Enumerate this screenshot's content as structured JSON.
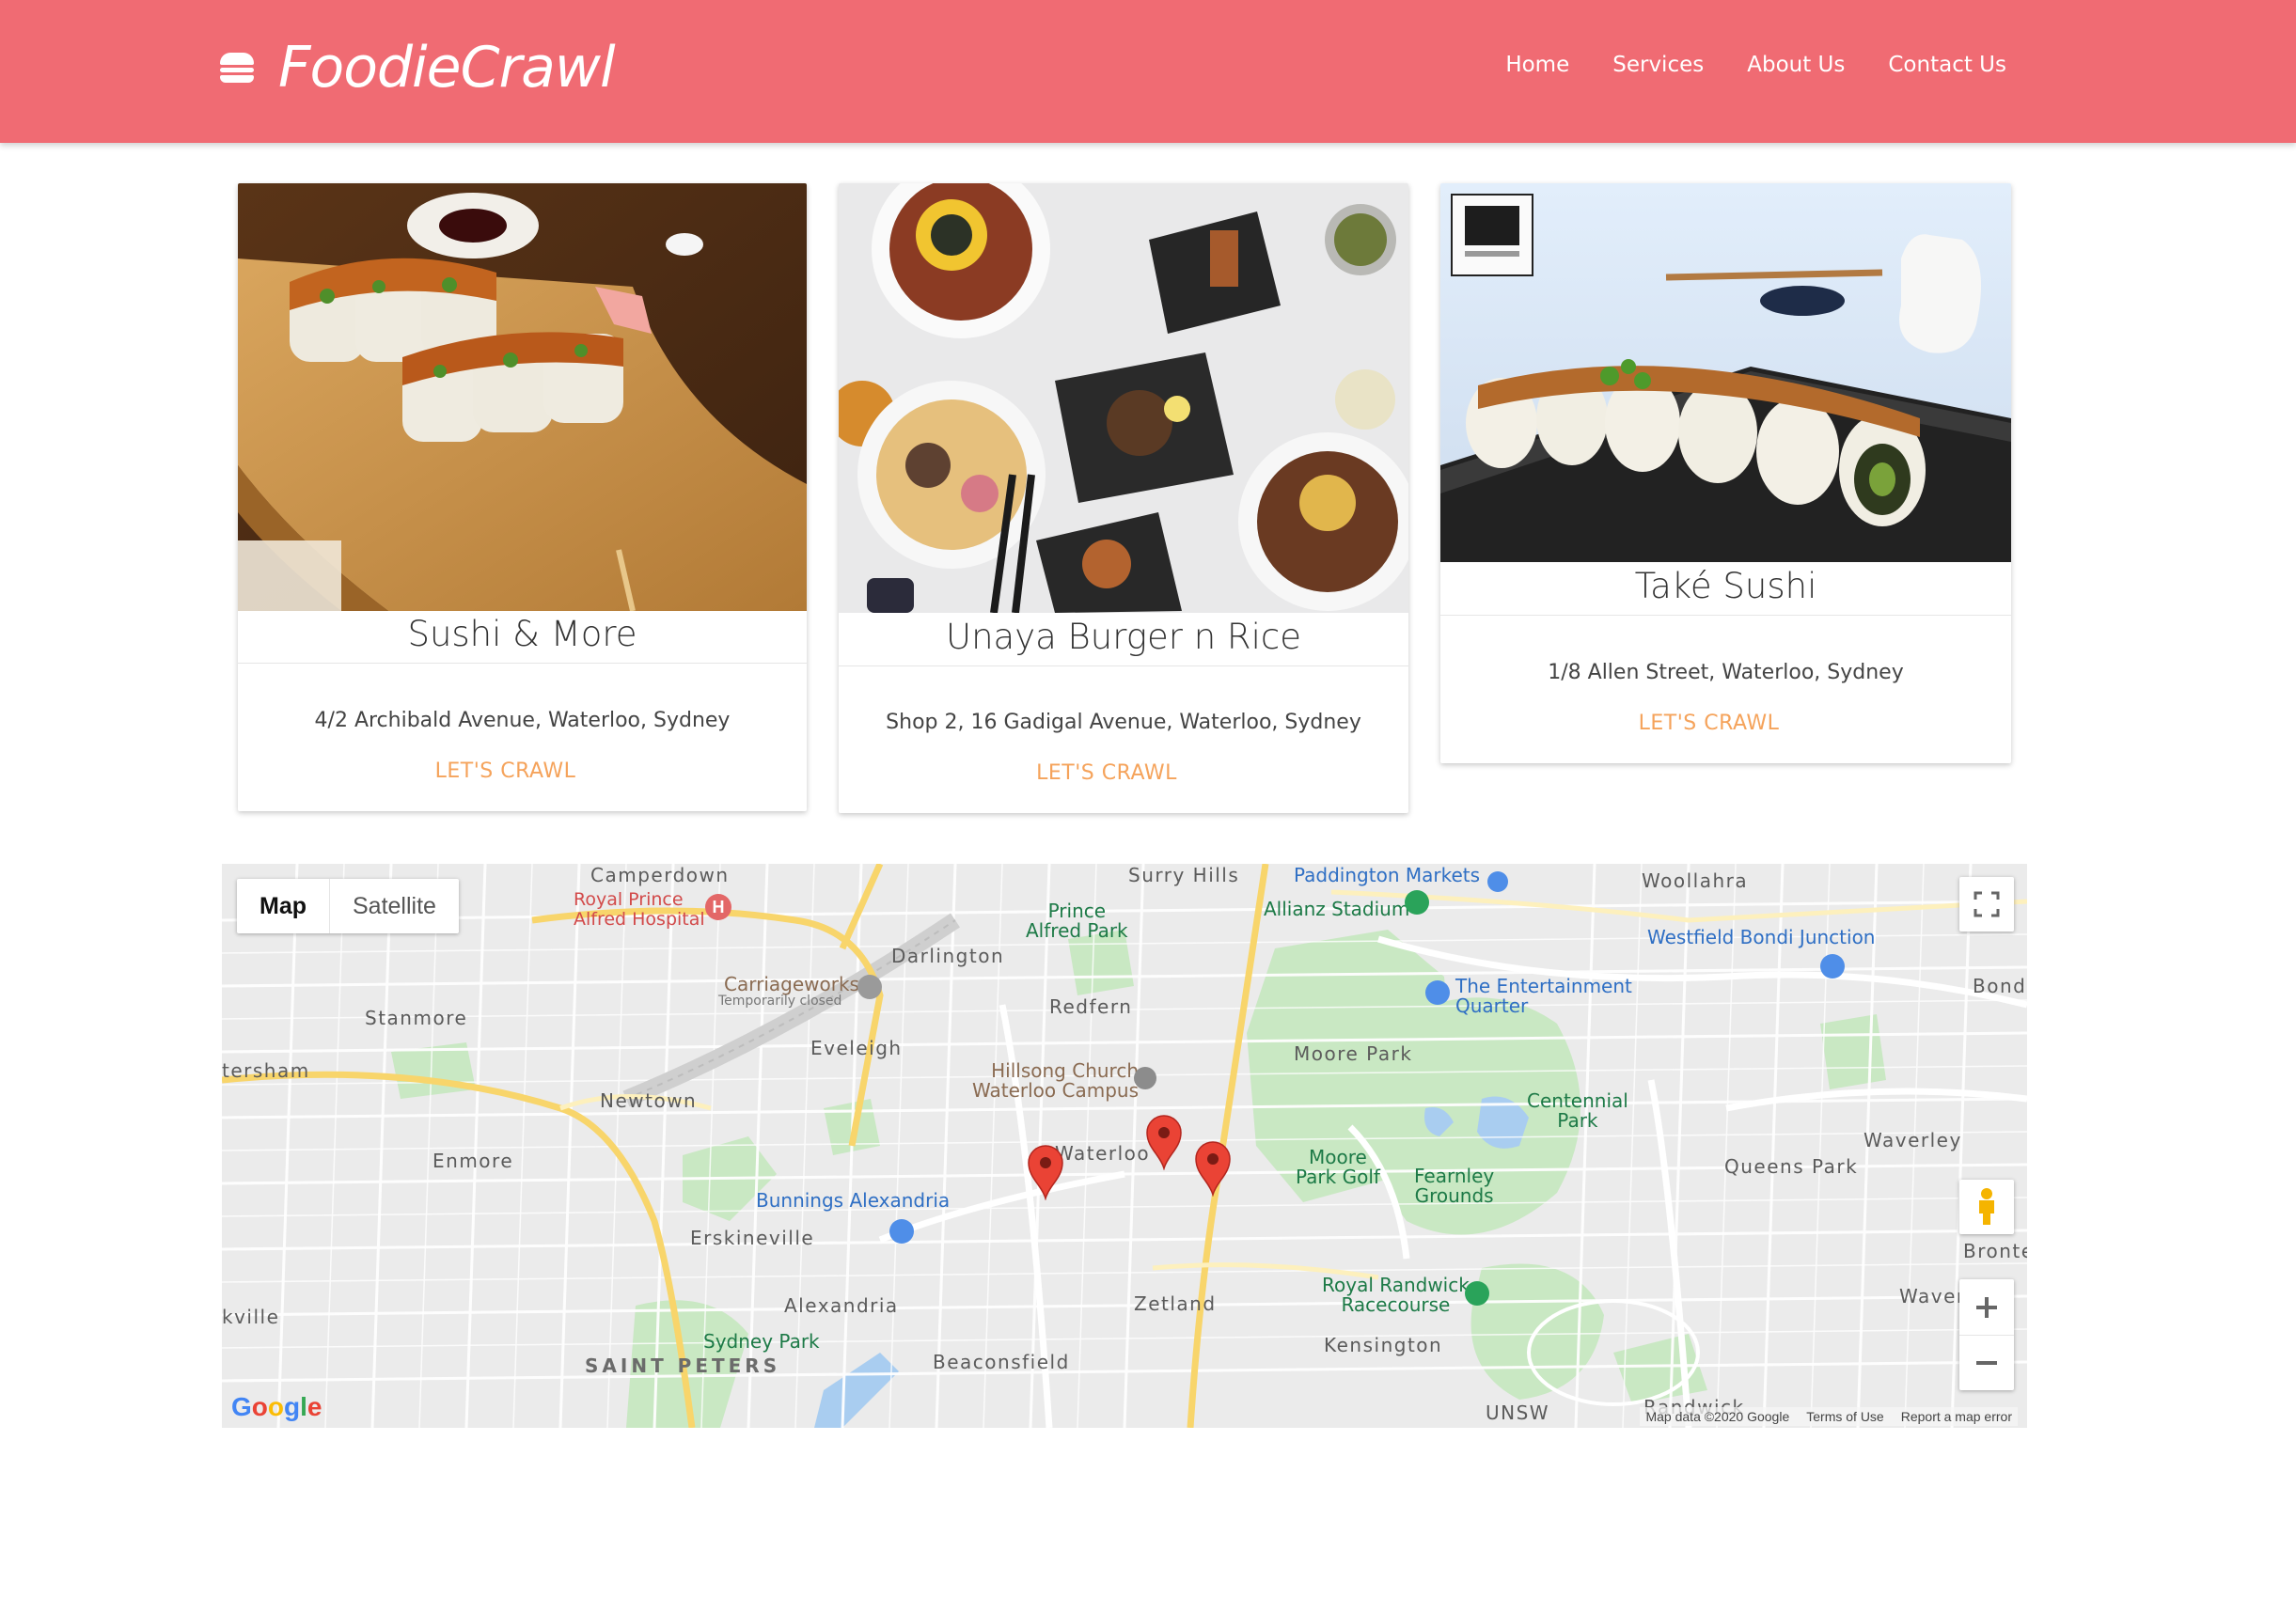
{
  "header": {
    "logo_text": "FoodieCrawl",
    "nav": [
      "Home",
      "Services",
      "About Us",
      "Contact Us"
    ]
  },
  "cards": [
    {
      "title": "Sushi & More",
      "address": "4/2 Archibald Avenue, Waterloo, Sydney",
      "link": "LET'S CRAWL"
    },
    {
      "title": "Unaya Burger n Rice",
      "address": "Shop 2, 16 Gadigal Avenue, Waterloo, Sydney",
      "link": "LET'S CRAWL"
    },
    {
      "title": "Také Sushi",
      "address": "1/8 Allen Street, Waterloo, Sydney",
      "link": "LET'S CRAWL"
    }
  ],
  "map": {
    "type_map": "Map",
    "type_satellite": "Satellite",
    "google": "Google",
    "attribution": [
      "Map data ©2020 Google",
      "Terms of Use",
      "Report a map error"
    ],
    "labels": {
      "camperdown": "Camperdown",
      "royal_prince": "Royal Prince\nAlfred Hospital",
      "surry_hills": "Surry Hills",
      "paddington_markets": "Paddington Markets",
      "woollahra": "Woollahra",
      "prince_alfred_park": "Prince\nAlfred Park",
      "allianz": "Allianz Stadium",
      "westfield": "Westfield Bondi Junction",
      "darlington": "Darlington",
      "carriageworks": "Carriageworks",
      "temporarily_closed": "Temporarily closed",
      "stanmore": "Stanmore",
      "redfern": "Redfern",
      "entertainment_quarter": "The Entertainment\nQuarter",
      "bondi": "Bond",
      "eveleigh": "Eveleigh",
      "moore_park": "Moore Park",
      "petersham": "tersham",
      "hillsong": "Hillsong Church\nWaterloo Campus",
      "centennial": "Centennial\nPark",
      "newtown": "Newtown",
      "waverley": "Waverley",
      "enmore": "Enmore",
      "waterloo": "Waterloo",
      "moore_park_golf": "Moore\nPark Golf",
      "fearnley": "Fearnley\nGrounds",
      "queens_park": "Queens Park",
      "bunnings": "Bunnings Alexandria",
      "bronte": "Bronte",
      "erskineville": "Erskineville",
      "alexandria": "Alexandria",
      "zetland": "Zetland",
      "royal_randwick": "Royal Randwick\nRacecourse",
      "waverley_e": "Waverl",
      "marrickville": "kville",
      "sydney_park": "Sydney Park",
      "kensington": "Kensington",
      "saint_peters": "SAINT PETERS",
      "beaconsfield": "Beaconsfield",
      "unsw": "UNSW",
      "randwick": "Randwick"
    }
  }
}
